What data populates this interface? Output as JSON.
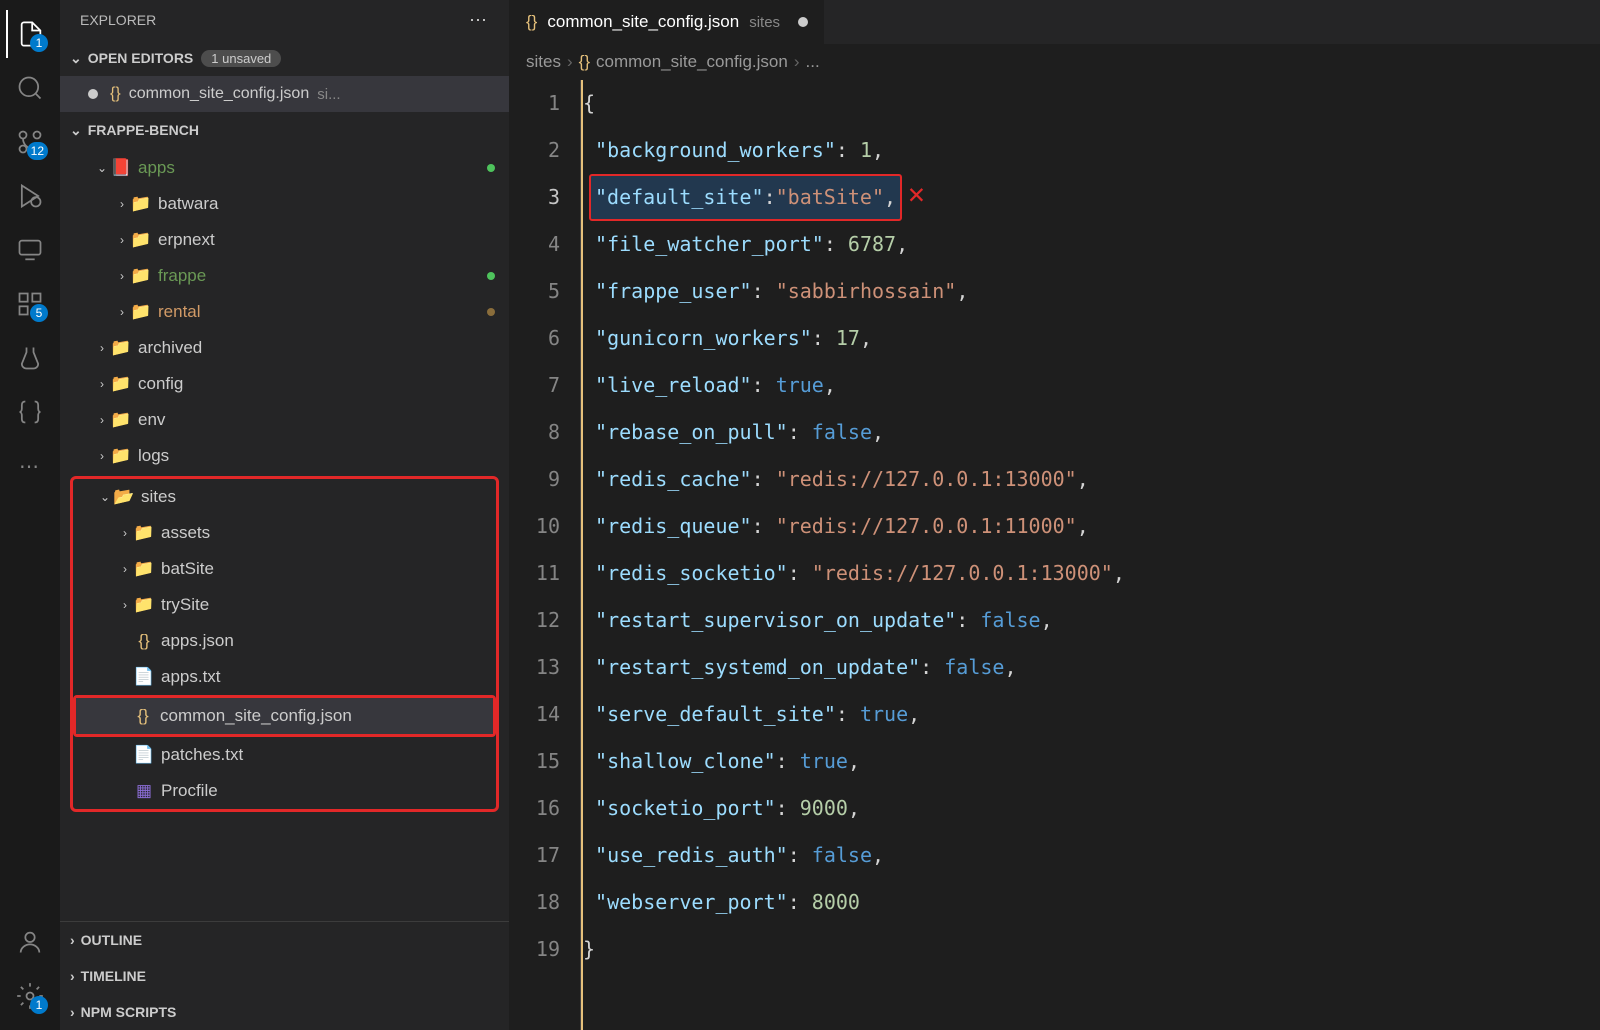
{
  "sidebar": {
    "title": "EXPLORER",
    "open_editors_label": "OPEN EDITORS",
    "unsaved_badge": "1 unsaved",
    "open_editor_file": "common_site_config.json",
    "open_editor_dir": "si...",
    "workspace": "FRAPPE-BENCH",
    "tree": {
      "apps": "apps",
      "batwara": "batwara",
      "erpnext": "erpnext",
      "frappe": "frappe",
      "rental": "rental",
      "archived": "archived",
      "config": "config",
      "env": "env",
      "logs": "logs",
      "sites": "sites",
      "assets": "assets",
      "batSite": "batSite",
      "trySite": "trySite",
      "apps_json": "apps.json",
      "apps_txt": "apps.txt",
      "common_site_config": "common_site_config.json",
      "patches_txt": "patches.txt",
      "procfile": "Procfile"
    },
    "outline": "OUTLINE",
    "timeline": "TIMELINE",
    "npm_scripts": "NPM SCRIPTS"
  },
  "activity_badges": {
    "explorer": "1",
    "scm": "12",
    "extensions": "5",
    "settings": "1"
  },
  "tab": {
    "filename": "common_site_config.json",
    "dir": "sites"
  },
  "breadcrumb": {
    "p1": "sites",
    "p2": "common_site_config.json",
    "p3": "..."
  },
  "code": {
    "lines": [
      "1",
      "2",
      "3",
      "4",
      "5",
      "6",
      "7",
      "8",
      "9",
      "10",
      "11",
      "12",
      "13",
      "14",
      "15",
      "16",
      "17",
      "18",
      "19"
    ],
    "l1_brace": "{",
    "l2_key": "\"background_workers\"",
    "l2_val": "1",
    "l3_key": "\"default_site\"",
    "l3_val": "\"batSite\"",
    "l4_key": "\"file_watcher_port\"",
    "l4_val": "6787",
    "l5_key": "\"frappe_user\"",
    "l5_val": "\"sabbirhossain\"",
    "l6_key": "\"gunicorn_workers\"",
    "l6_val": "17",
    "l7_key": "\"live_reload\"",
    "l7_val": "true",
    "l8_key": "\"rebase_on_pull\"",
    "l8_val": "false",
    "l9_key": "\"redis_cache\"",
    "l9_val": "\"redis://127.0.0.1:13000\"",
    "l10_key": "\"redis_queue\"",
    "l10_val": "\"redis://127.0.0.1:11000\"",
    "l11_key": "\"redis_socketio\"",
    "l11_val": "\"redis://127.0.0.1:13000\"",
    "l12_key": "\"restart_supervisor_on_update\"",
    "l12_val": "false",
    "l13_key": "\"restart_systemd_on_update\"",
    "l13_val": "false",
    "l14_key": "\"serve_default_site\"",
    "l14_val": "true",
    "l15_key": "\"shallow_clone\"",
    "l15_val": "true",
    "l16_key": "\"socketio_port\"",
    "l16_val": "9000",
    "l17_key": "\"use_redis_auth\"",
    "l17_val": "false",
    "l18_key": "\"webserver_port\"",
    "l18_val": "8000",
    "l19_brace": "}"
  }
}
